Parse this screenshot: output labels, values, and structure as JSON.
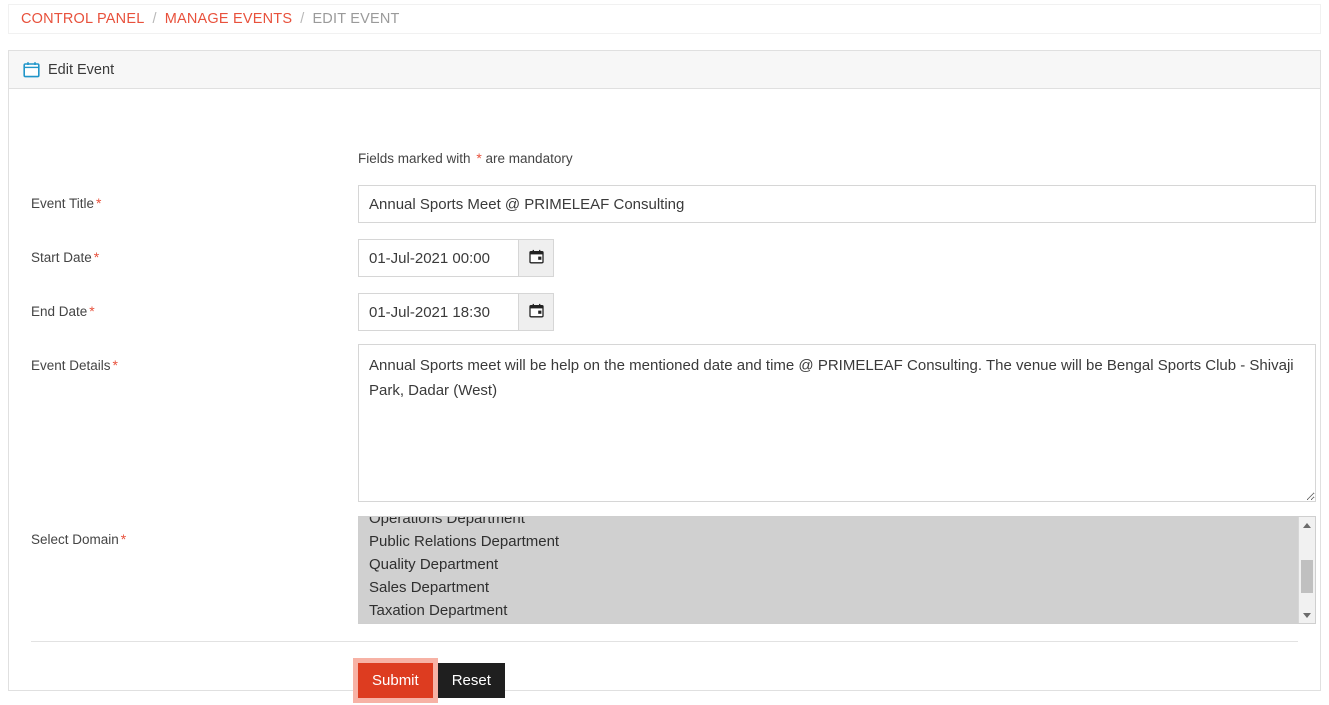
{
  "breadcrumb": {
    "items": [
      {
        "label": "CONTROL PANEL",
        "type": "link"
      },
      {
        "label": "MANAGE EVENTS",
        "type": "link"
      },
      {
        "label": "EDIT EVENT",
        "type": "current"
      }
    ],
    "separator": "/"
  },
  "panel": {
    "title": "Edit Event",
    "icon": "calendar-icon"
  },
  "form": {
    "mandatory_note_prefix": "Fields marked with",
    "mandatory_note_star": "*",
    "mandatory_note_suffix": "are mandatory",
    "required_marker": "*",
    "fields": {
      "event_title": {
        "label": "Event Title",
        "value": "Annual Sports Meet @ PRIMELEAF Consulting",
        "placeholder": "Event Title"
      },
      "start_date": {
        "label": "Start Date",
        "value": "01-Jul-2021 00:00",
        "placeholder": "Start Date",
        "picker_icon": "calendar-icon"
      },
      "end_date": {
        "label": "End Date",
        "value": "01-Jul-2021 18:30",
        "placeholder": "End Date",
        "picker_icon": "calendar-icon"
      },
      "event_details": {
        "label": "Event Details",
        "value": "Annual Sports meet will be help on the mentioned date and time @ PRIMELEAF Consulting. The venue will be Bengal Sports Club - Shivaji Park, Dadar (West)",
        "placeholder": "Event Details"
      },
      "select_domain": {
        "label": "Select Domain",
        "options": [
          "Operations Department",
          "Public Relations Department",
          "Quality Department",
          "Sales Department",
          "Taxation Department"
        ],
        "scroll_position": "near-bottom"
      }
    }
  },
  "actions": {
    "submit_label": "Submit",
    "reset_label": "Reset"
  },
  "colors": {
    "link": "#e8513c",
    "required_star": "#e8513c",
    "submit_bg": "#dd3c20",
    "submit_focus_ring": "#f7b2a5",
    "reset_bg": "#1f1f1f",
    "panel_header_bg": "#f7f7f7",
    "select_bg": "#d0d0d0",
    "calendar_icon": "#2196c9"
  }
}
